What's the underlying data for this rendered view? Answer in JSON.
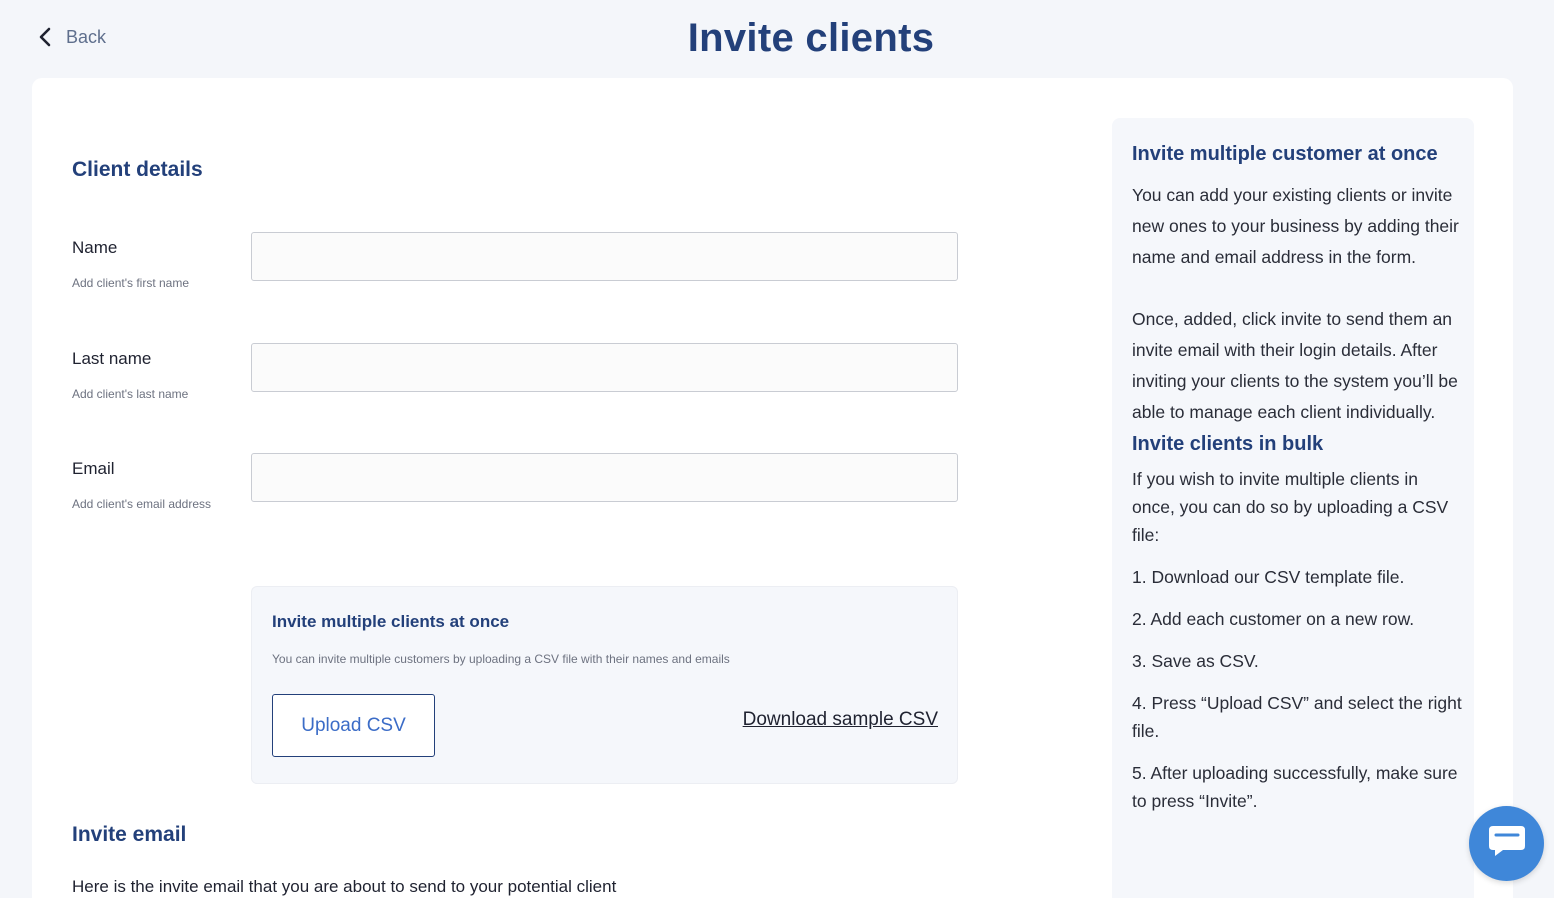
{
  "header": {
    "back_label": "Back",
    "title": "Invite clients"
  },
  "form": {
    "section_title": "Client details",
    "fields": [
      {
        "label": "Name",
        "hint": "Add client's first name",
        "value": ""
      },
      {
        "label": "Last name",
        "hint": "Add client's last name",
        "value": ""
      },
      {
        "label": "Email",
        "hint": "Add client's email address",
        "value": ""
      }
    ]
  },
  "bulk": {
    "title": "Invite multiple clients at once",
    "description": "You can invite multiple customers by uploading a CSV file with their names and emails",
    "upload_label": "Upload CSV",
    "download_label": "Download sample CSV"
  },
  "invite_email": {
    "section_title": "Invite email",
    "description": "Here is the invite email that you are about to send to your potential client"
  },
  "side": {
    "heading1": "Invite multiple customer at once",
    "para1": "You can add your existing clients or invite new ones to your business by adding their name and email address in the form.",
    "para2": "Once, added, click invite to send them an invite email with their login details. After inviting your clients to the system you’ll be able to manage each client individually.",
    "heading2": "Invite clients in bulk",
    "para3": "If you wish to invite multiple clients in once, you can do so by uploading a CSV file:",
    "steps": [
      "1. Download our CSV template file.",
      "2. Add each customer on a new row.",
      "3. Save as CSV.",
      "4. Press “Upload CSV” and select the right file.",
      "5. After uploading successfully, make sure to press “Invite”."
    ]
  },
  "colors": {
    "accent": "#23407a",
    "link_blue": "#3b6cc7",
    "chat_button": "#3f87d9",
    "background": "#f4f6fa"
  },
  "icons": {
    "back": "chevron-left-icon",
    "chat": "chat-bubble-icon"
  }
}
